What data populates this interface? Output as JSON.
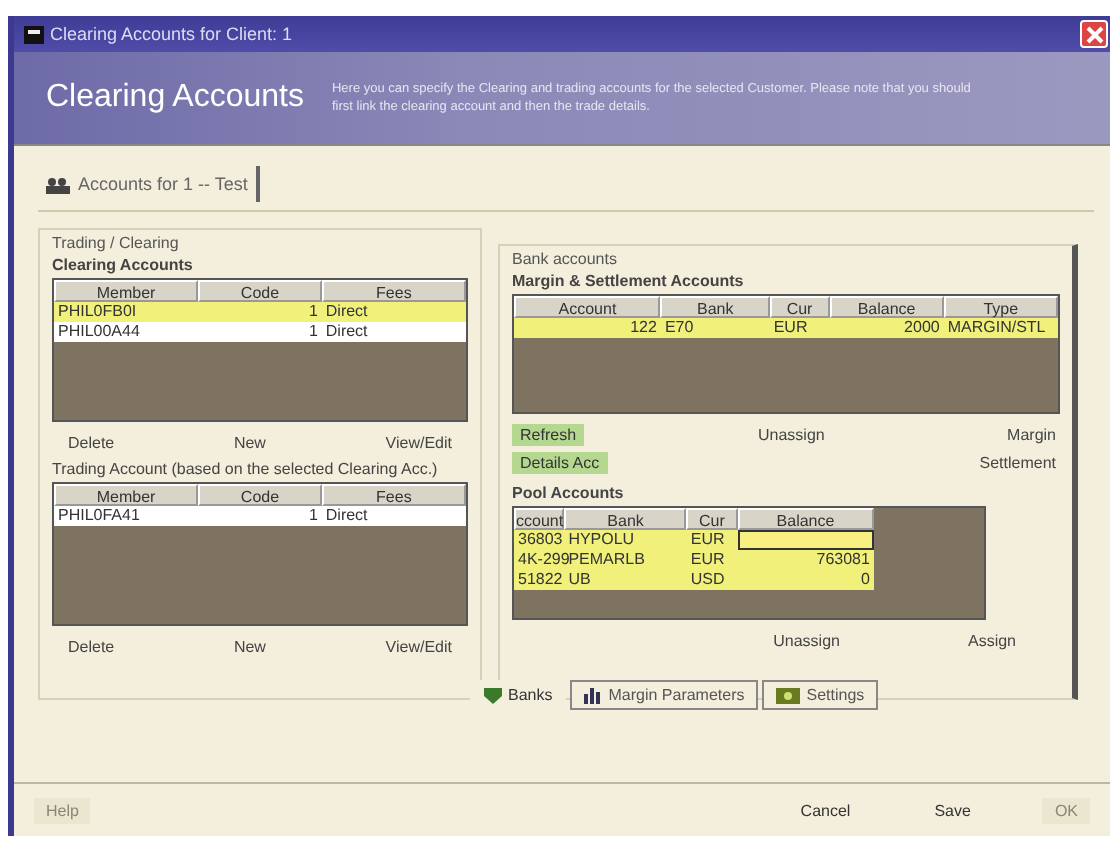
{
  "window": {
    "title": "Clearing Accounts for Client: 1"
  },
  "header": {
    "title": "Clearing Accounts",
    "description": "Here you can specify the Clearing and trading accounts for the selected Customer. Please note that you should first link the clearing account and then the trade details."
  },
  "tab": {
    "label": "Accounts for 1 -- Test"
  },
  "trading_clearing": {
    "title": "Trading / Clearing",
    "clearing_accounts": {
      "title": "Clearing Accounts",
      "columns": [
        "Member",
        "Code",
        "Fees"
      ],
      "rows": [
        {
          "cells": [
            "PHIL0FB0I",
            "1",
            "Direct"
          ],
          "selected": true
        },
        {
          "cells": [
            "PHIL00A44",
            "1",
            "Direct"
          ],
          "selected": false
        }
      ],
      "buttons": [
        "Delete",
        "New",
        "View/Edit"
      ]
    },
    "trading_accounts": {
      "title": "Trading Account (based on the selected Clearing Acc.)",
      "columns": [
        "Member",
        "Code",
        "Fees"
      ],
      "rows": [
        {
          "cells": [
            "PHIL0FA41",
            "1",
            "Direct"
          ],
          "selected": false
        }
      ],
      "buttons": [
        "Delete",
        "New",
        "View/Edit"
      ]
    }
  },
  "bank_accounts": {
    "title": "Bank accounts",
    "margin_settlement": {
      "title": "Margin & Settlement Accounts",
      "columns": [
        "Account",
        "Bank",
        "Cur",
        "Balance",
        "Type"
      ],
      "rows": [
        {
          "cells": [
            "122",
            "E70",
            "EUR",
            "2000",
            "MARGIN/STL"
          ],
          "selected": true
        }
      ]
    },
    "buttons": [
      {
        "label": "Refresh",
        "kind": "green"
      },
      {
        "label": "Unassign",
        "kind": "plain"
      },
      {
        "label": "Margin",
        "kind": "plain"
      },
      {
        "label": "Details Acc",
        "kind": "green"
      },
      {
        "label": "Settlement",
        "kind": "plain"
      }
    ],
    "pool_accounts": {
      "title": "Pool Accounts",
      "columns": [
        "ccount",
        "Bank",
        "Cur",
        "Balance"
      ],
      "rows": [
        {
          "cells": [
            "36803",
            "HYPOLU",
            "EUR",
            ""
          ],
          "selected": true
        },
        {
          "cells": [
            "4K-299",
            "PEMARLB",
            "EUR",
            "763081"
          ],
          "selected": true
        },
        {
          "cells": [
            "51822",
            "UB",
            "USD",
            "0"
          ],
          "selected": true
        }
      ],
      "buttons": [
        "Unassign",
        "Assign"
      ]
    }
  },
  "bottom_tabs": [
    {
      "label": "Banks",
      "selected": true
    },
    {
      "label": "Margin Parameters",
      "selected": false
    },
    {
      "label": "Settings",
      "selected": false
    }
  ],
  "footer_buttons": [
    {
      "label": "Help",
      "disabled": true
    },
    {
      "label": "Cancel",
      "disabled": false
    },
    {
      "label": "Save",
      "disabled": false
    },
    {
      "label": "OK",
      "disabled": true
    }
  ]
}
